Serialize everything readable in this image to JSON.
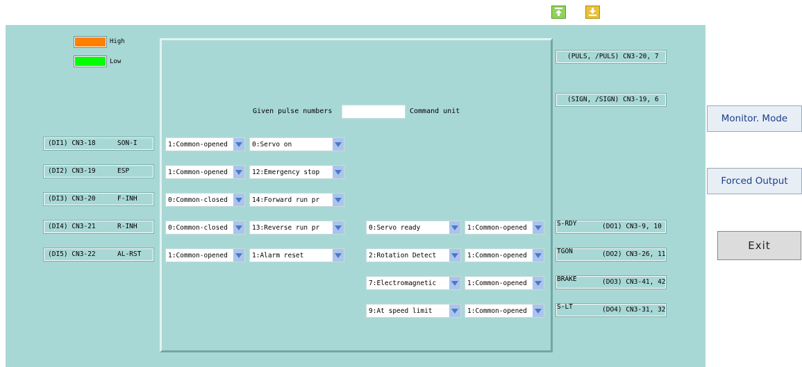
{
  "toolbar": {
    "upload_icon": "upload-icon",
    "download_icon": "download-icon"
  },
  "legend": [
    {
      "label": "High",
      "color": "#ff8000"
    },
    {
      "label": "Low",
      "color": "#00ff00"
    }
  ],
  "pulse_inputs": [
    {
      "label": "(PULS, /PULS) CN3-20, 7"
    },
    {
      "label": "(SIGN, /SIGN) CN3-19, 6"
    }
  ],
  "pulse": {
    "label": "Given pulse numbers",
    "value": "",
    "unit": "Command unit"
  },
  "digital_inputs": [
    {
      "pin": "(DI1) CN3-18",
      "name": "SON-I",
      "logic": "1:Common-opened",
      "function": "0:Servo on"
    },
    {
      "pin": "(DI2) CN3-19",
      "name": "ESP",
      "logic": "1:Common-opened",
      "function": "12:Emergency stop"
    },
    {
      "pin": "(DI3) CN3-20",
      "name": "F-INH",
      "logic": "0:Common-closed",
      "function": "14:Forward run pr"
    },
    {
      "pin": "(DI4) CN3-21",
      "name": "R-INH",
      "logic": "0:Common-closed",
      "function": "13:Reverse run pr"
    },
    {
      "pin": "(DI5) CN3-22",
      "name": "AL-RST",
      "logic": "1:Common-opened",
      "function": "1:Alarm reset"
    }
  ],
  "digital_outputs": [
    {
      "function": "0:Servo ready",
      "logic": "1:Common-opened",
      "name": "S-RDY",
      "pin": "(DO1) CN3-9, 10"
    },
    {
      "function": "2:Rotation Detect",
      "logic": "1:Common-opened",
      "name": "TGON",
      "pin": "(DO2) CN3-26, 11"
    },
    {
      "function": "7:Electromagnetic",
      "logic": "1:Common-opened",
      "name": "BRAKE",
      "pin": "(DO3) CN3-41, 42"
    },
    {
      "function": "9:At speed limit",
      "logic": "1:Common-opened",
      "name": "S-LT",
      "pin": "(DO4) CN3-31, 32"
    }
  ],
  "buttons": {
    "monitor": "Monitor. Mode",
    "forced": "Forced Output",
    "exit": "Exit"
  }
}
